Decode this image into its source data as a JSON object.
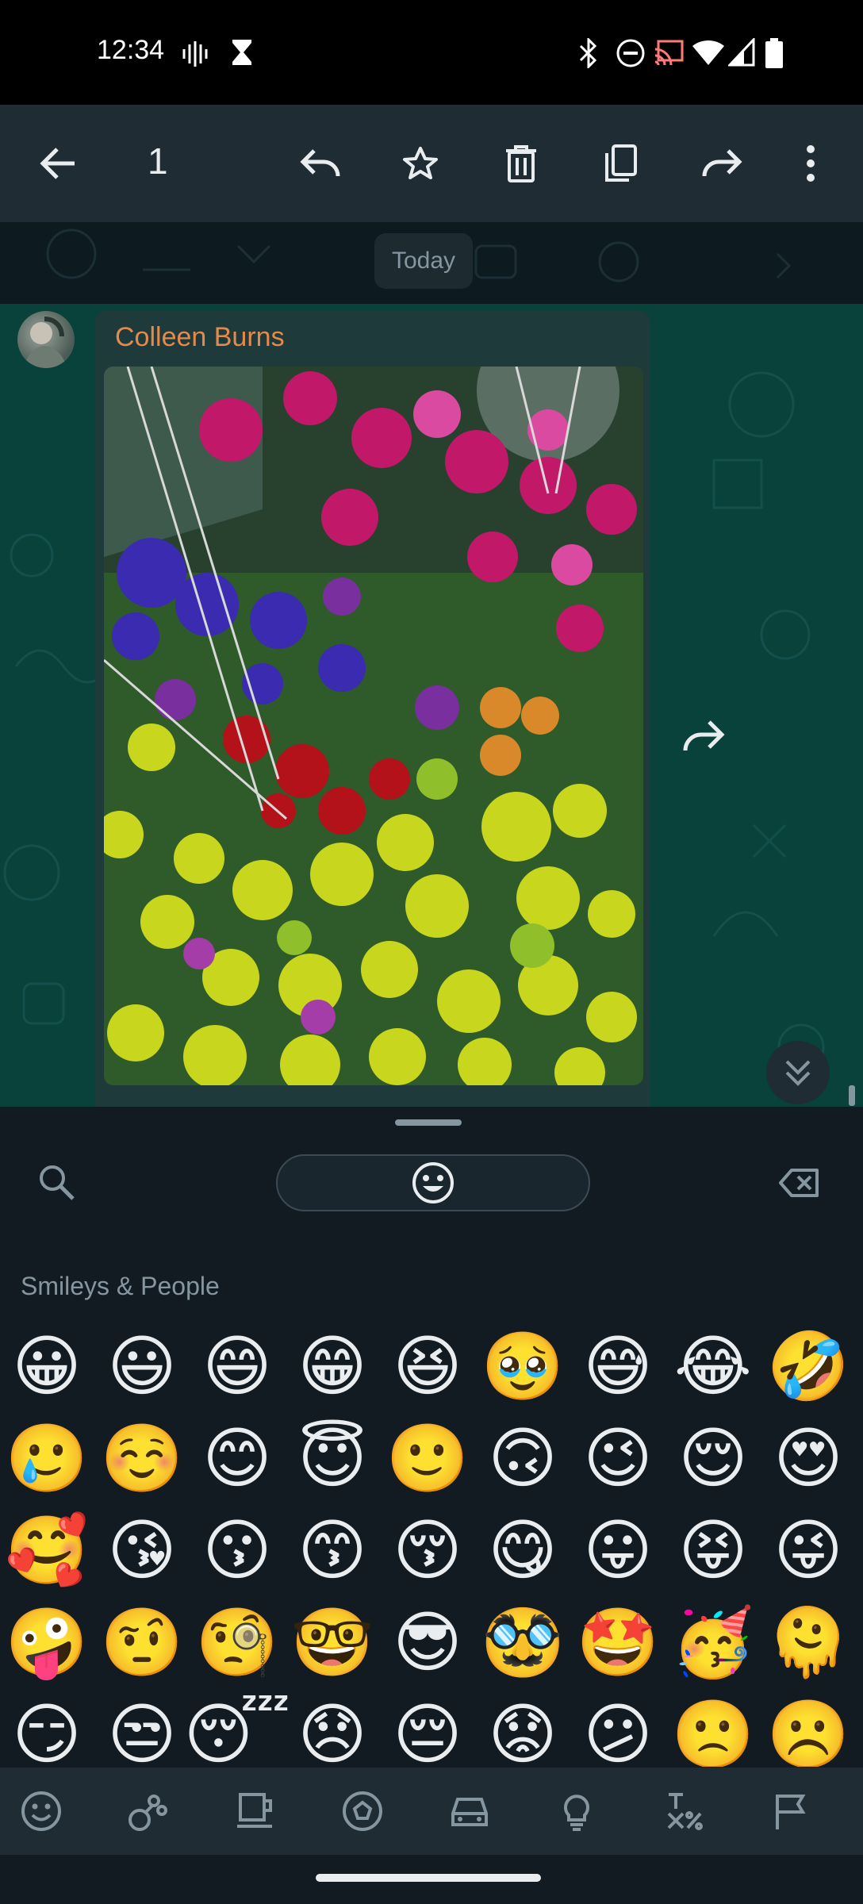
{
  "status_bar": {
    "time": "12:34",
    "icons": [
      "voicemail-icon",
      "hourglass-icon",
      "bluetooth-icon",
      "do-not-disturb-icon",
      "cast-icon",
      "wifi-icon",
      "cell-signal-icon",
      "battery-icon"
    ]
  },
  "action_bar": {
    "selected_count": "1",
    "actions": [
      "back-icon",
      "reply-icon",
      "star-icon",
      "delete-icon",
      "copy-icon",
      "forward-icon",
      "more-options-icon"
    ]
  },
  "chat": {
    "date_chip": "Today",
    "message": {
      "sender": "Colleen Burns",
      "media": "photo of colorful flowers"
    }
  },
  "emoji_keyboard": {
    "category_title": "Smileys & People",
    "rows": [
      [
        "😀",
        "😃",
        "😄",
        "😁",
        "😆",
        "🥹",
        "😅",
        "😂",
        "🤣"
      ],
      [
        "🥲",
        "☺️",
        "😊",
        "😇",
        "🙂",
        "🙃",
        "😉",
        "😌",
        "😍"
      ],
      [
        "🥰",
        "😘",
        "😗",
        "😙",
        "😚",
        "😋",
        "😛",
        "😝",
        "😜"
      ],
      [
        "🤪",
        "🤨",
        "🧐",
        "🤓",
        "😎",
        "🥸",
        "🤩",
        "🥳",
        "🫠"
      ],
      [
        "😏",
        "😒",
        "😴",
        "😞",
        "😔",
        "😟",
        "😕",
        "🙁",
        "☹️"
      ]
    ],
    "categories": [
      "smiley-icon",
      "animals-nature-icon",
      "food-drink-icon",
      "activity-icon",
      "travel-icon",
      "objects-icon",
      "symbols-icon",
      "flags-icon"
    ]
  },
  "colors": {
    "accent": "#00a884",
    "sender_name": "#e58a4b",
    "header_bg": "#1f2c34",
    "keyboard_bg": "#121b22"
  }
}
